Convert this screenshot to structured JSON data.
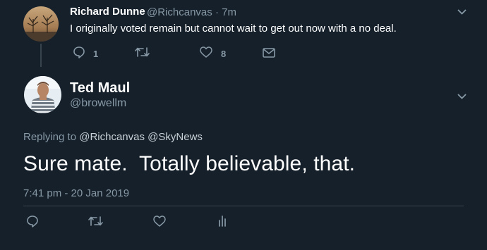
{
  "parent_tweet": {
    "display_name": "Richard Dunne",
    "handle": "@Richcanvas",
    "separator": "·",
    "time": "7m",
    "text": "I originally voted remain but cannot wait to get out now with a no deal.",
    "actions": {
      "reply_count": "1",
      "like_count": "8"
    },
    "icons": [
      "reply-icon",
      "retweet-icon",
      "like-icon",
      "message-icon",
      "chevron-down-icon"
    ]
  },
  "main_tweet": {
    "display_name": "Ted Maul",
    "handle": "@browellm",
    "replying_prefix": "Replying to",
    "replying_to": [
      "@Richcanvas",
      "@SkyNews"
    ],
    "text": "Sure mate.  Totally believable, that.",
    "timestamp": "7:41 pm - 20 Jan 2019",
    "icons": [
      "reply-icon",
      "retweet-icon",
      "like-icon",
      "analytics-icon",
      "chevron-down-icon"
    ]
  },
  "colors": {
    "background": "#15202b",
    "primary_text": "#ffffff",
    "secondary_text": "#8899a6",
    "divider": "#38444d"
  }
}
